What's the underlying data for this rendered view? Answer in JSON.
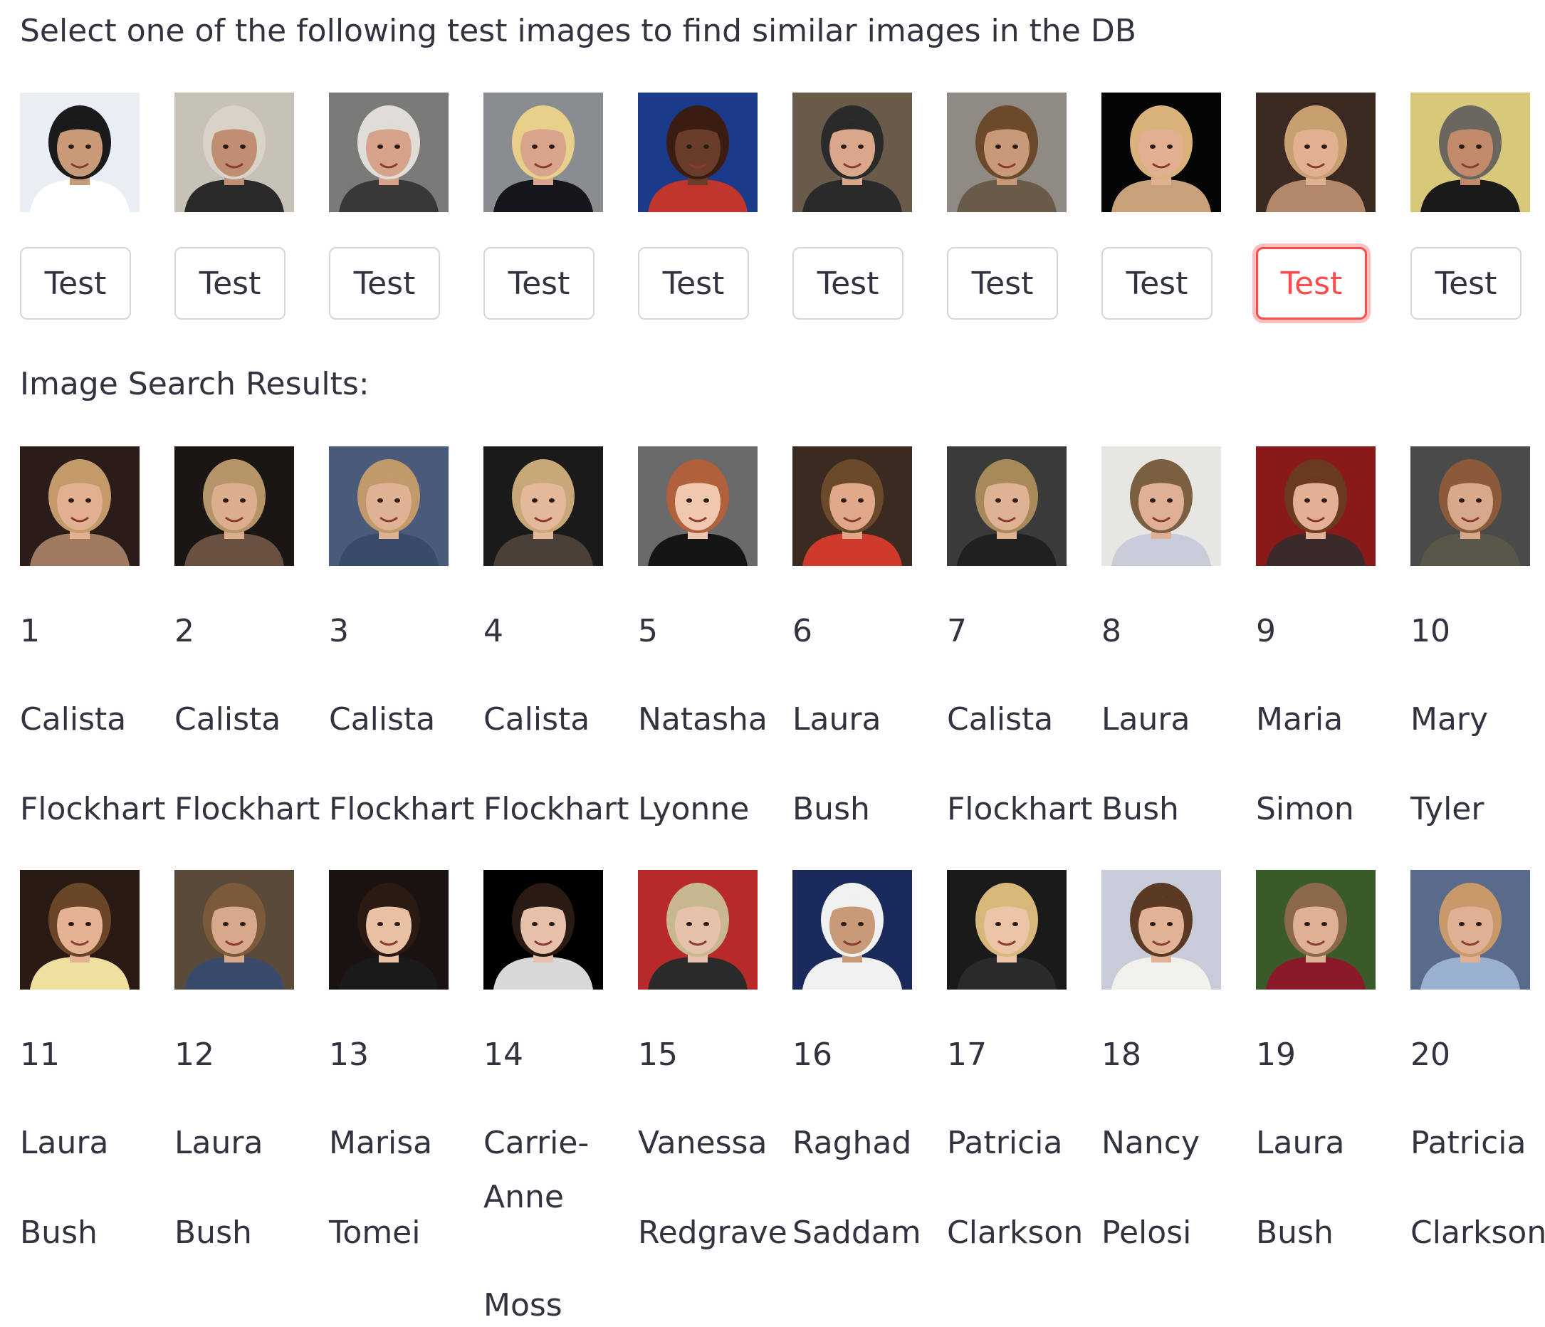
{
  "header": {
    "prompt": "Select one of the following test images to find similar images in the DB",
    "results_title": "Image Search Results:"
  },
  "test_images": [
    {
      "button_label": "Test",
      "active": false,
      "bg": "#e9eef5",
      "shirt": "#ffffff",
      "hair": "#1a1a1a",
      "skin": "#c99a78",
      "backdrop": "#0b0b0b"
    },
    {
      "button_label": "Test",
      "active": false,
      "bg": "#c7c2b7",
      "shirt": "#2a2a2a",
      "hair": "#d9d2c8",
      "skin": "#c08e72",
      "backdrop": "#3a3a3a"
    },
    {
      "button_label": "Test",
      "active": false,
      "bg": "#7a7a78",
      "shirt": "#3a3836",
      "hair": "#e0dcd8",
      "skin": "#d6a38a",
      "backdrop": "#555"
    },
    {
      "button_label": "Test",
      "active": false,
      "bg": "#8a8d90",
      "shirt": "#14161c",
      "hair": "#e8cf8a",
      "skin": "#d9a48c",
      "backdrop": "#000"
    },
    {
      "button_label": "Test",
      "active": false,
      "bg": "#1a3a8a",
      "shirt": "#c0362d",
      "hair": "#3a1c12",
      "skin": "#6a3d2a",
      "backdrop": "#1a3a8a"
    },
    {
      "button_label": "Test",
      "active": false,
      "bg": "#6a5a4a",
      "shirt": "#2a2a2a",
      "hair": "#2a2a2a",
      "skin": "#d9a88a",
      "backdrop": "#3a2a20"
    },
    {
      "button_label": "Test",
      "active": false,
      "bg": "#8f8a84",
      "shirt": "#6a5a4a",
      "hair": "#6a4a2a",
      "skin": "#c89a7a",
      "backdrop": "#7a7570"
    },
    {
      "button_label": "Test",
      "active": false,
      "bg": "#050505",
      "shirt": "#c8a07a",
      "hair": "#d8b27a",
      "skin": "#e0b090",
      "backdrop": "#050505"
    },
    {
      "button_label": "Test",
      "active": true,
      "bg": "#3a2a22",
      "shirt": "#b2876a",
      "hair": "#c8a070",
      "skin": "#e0b090",
      "backdrop": "#1a0a0a"
    },
    {
      "button_label": "Test",
      "active": false,
      "bg": "#d8c87a",
      "shirt": "#1a1a1a",
      "hair": "#6a6660",
      "skin": "#c28a6a",
      "backdrop": "#c8b25a"
    }
  ],
  "results": [
    {
      "rank": "1",
      "first": "Calista",
      "last": "Flockhart",
      "bg": "#2a1c18",
      "shirt": "#a07a60",
      "hair": "#c49a6a",
      "skin": "#e0b090"
    },
    {
      "rank": "2",
      "first": "Calista",
      "last": "Flockhart",
      "bg": "#1a1614",
      "shirt": "#6a5040",
      "hair": "#b6946a",
      "skin": "#dcae8e"
    },
    {
      "rank": "3",
      "first": "Calista",
      "last": "Flockhart",
      "bg": "#4a5a7a",
      "shirt": "#3a4a6a",
      "hair": "#c09a6a",
      "skin": "#e0b294"
    },
    {
      "rank": "4",
      "first": "Calista",
      "last": "Flockhart",
      "bg": "#1a1a1a",
      "shirt": "#4a4038",
      "hair": "#c8a878",
      "skin": "#e4b89a"
    },
    {
      "rank": "5",
      "first": "Natasha",
      "last": "Lyonne",
      "bg": "#6a6a6a",
      "shirt": "#151515",
      "hair": "#b0603a",
      "skin": "#f0c8b0"
    },
    {
      "rank": "6",
      "first": "Laura",
      "last": "Bush",
      "bg": "#3a2a20",
      "shirt": "#d03a2a",
      "hair": "#6a4a2a",
      "skin": "#e0a888"
    },
    {
      "rank": "7",
      "first": "Calista",
      "last": "Flockhart",
      "bg": "#3a3a3a",
      "shirt": "#202020",
      "hair": "#a88a5a",
      "skin": "#e0b294"
    },
    {
      "rank": "8",
      "first": "Laura",
      "last": "Bush",
      "bg": "#e8e6e2",
      "shirt": "#c8ccd8",
      "hair": "#7a6040",
      "skin": "#e0b096"
    },
    {
      "rank": "9",
      "first": "Maria",
      "last": "Simon",
      "bg": "#8a1a1a",
      "shirt": "#3a2a2a",
      "hair": "#6a3a20",
      "skin": "#e4b094"
    },
    {
      "rank": "10",
      "first": "Mary",
      "last": "Tyler",
      "bg": "#4a4a4a",
      "shirt": "#5a5648",
      "hair": "#8a5a3a",
      "skin": "#d8a88a"
    },
    {
      "rank": "11",
      "first": "Laura",
      "last": "Bush",
      "bg": "#2a1a14",
      "shirt": "#f0e0a0",
      "hair": "#6a4628",
      "skin": "#e6b294"
    },
    {
      "rank": "12",
      "first": "Laura",
      "last": "Bush",
      "bg": "#5a4a3a",
      "shirt": "#3a4a6a",
      "hair": "#7a5a3a",
      "skin": "#d8a88a"
    },
    {
      "rank": "13",
      "first": "Marisa",
      "last": "Tomei",
      "bg": "#1a1210",
      "shirt": "#1a1a1a",
      "hair": "#2a1a12",
      "skin": "#e8c0a4"
    },
    {
      "rank": "14",
      "first": "Carrie-",
      "second": "Anne",
      "last": "Moss",
      "bg": "#000000",
      "shirt": "#d8d8d8",
      "hair": "#2a1a14",
      "skin": "#e6c0a8"
    },
    {
      "rank": "15",
      "first": "Vanessa",
      "last": "Redgrave",
      "bg": "#b82a2a",
      "shirt": "#2a2a2a",
      "hair": "#c8b890",
      "skin": "#e6c2aa"
    },
    {
      "rank": "16",
      "first": "Raghad",
      "last": "Saddam",
      "bg": "#1a2a5a",
      "shirt": "#f0f0f0",
      "hair": "#f0f0f0",
      "skin": "#c89a78"
    },
    {
      "rank": "17",
      "first": "Patricia",
      "last": "Clarkson",
      "bg": "#1a1a1a",
      "shirt": "#2a2a2a",
      "hair": "#d8b87a",
      "skin": "#ecc4a8"
    },
    {
      "rank": "18",
      "first": "Nancy",
      "last": "Pelosi",
      "bg": "#c8ccd8",
      "shirt": "#f2f0ea",
      "hair": "#5a3a24",
      "skin": "#e2b294"
    },
    {
      "rank": "19",
      "first": "Laura",
      "last": "Bush",
      "bg": "#3a5a2a",
      "shirt": "#8a1a2a",
      "hair": "#8a6a4a",
      "skin": "#e0b094"
    },
    {
      "rank": "20",
      "first": "Patricia",
      "last": "Clarkson",
      "bg": "#5a6a8a",
      "shirt": "#9ab0d0",
      "hair": "#c89a6a",
      "skin": "#e0b094"
    }
  ]
}
